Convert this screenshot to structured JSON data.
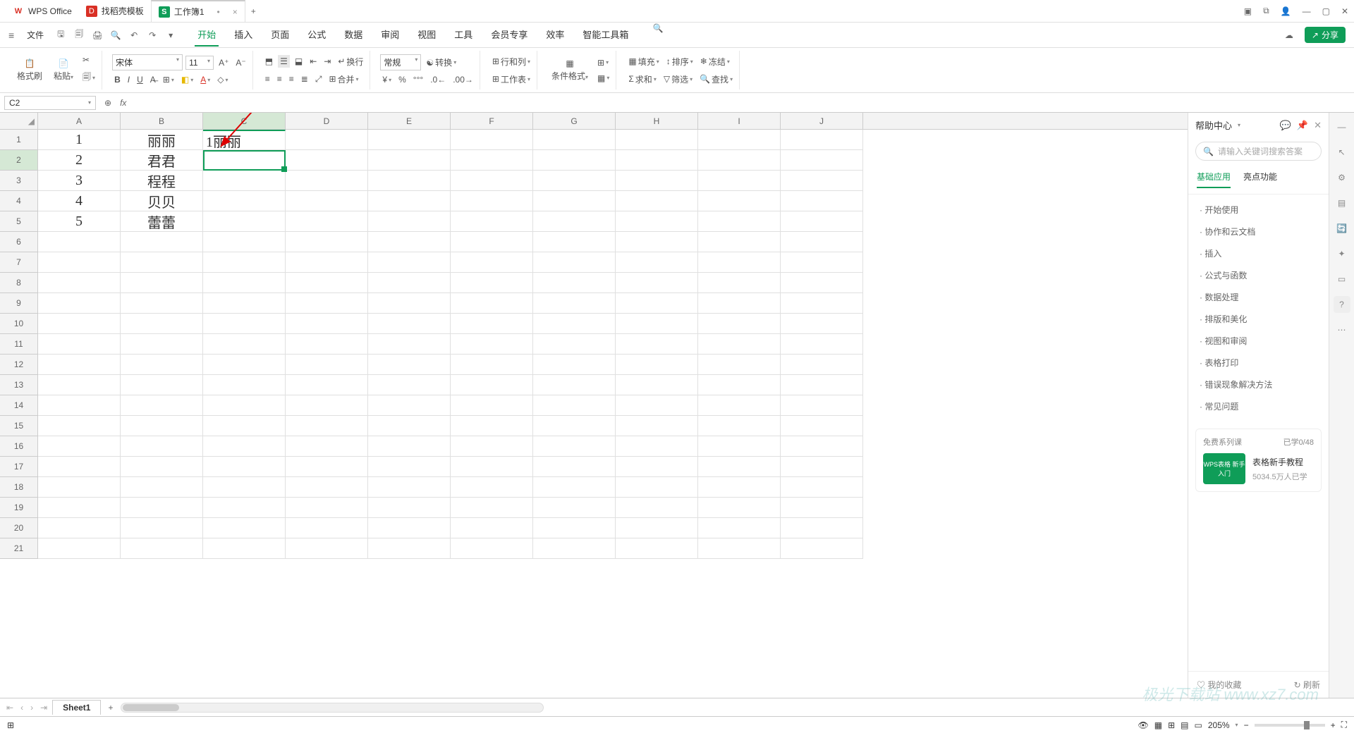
{
  "titlebar": {
    "tab1": "WPS Office",
    "tab2": "找稻壳模板",
    "tab3": "工作簿1",
    "tab3_icon": "S",
    "close": "×",
    "dot": "•",
    "add": "+"
  },
  "menubar": {
    "file": "文件",
    "tabs": [
      "开始",
      "插入",
      "页面",
      "公式",
      "数据",
      "审阅",
      "视图",
      "工具",
      "会员专享",
      "效率",
      "智能工具箱"
    ],
    "share": "分享"
  },
  "ribbon": {
    "format_painter": "格式刷",
    "paste": "粘贴",
    "font": "宋体",
    "size": "11",
    "wrap": "换行",
    "merge": "合并",
    "number_format": "常规",
    "convert": "转换",
    "rowcol": "行和列",
    "worksheet": "工作表",
    "cond_fmt": "条件格式",
    "fill": "填充",
    "sort": "排序",
    "freeze": "冻结",
    "sum": "求和",
    "filter": "筛选",
    "find": "查找"
  },
  "formula": {
    "namebox": "C2",
    "fx": "fx"
  },
  "columns": [
    "A",
    "B",
    "C",
    "D",
    "E",
    "F",
    "G",
    "H",
    "I",
    "J"
  ],
  "rows": [
    1,
    2,
    3,
    4,
    5,
    6,
    7,
    8,
    9,
    10,
    11,
    12,
    13,
    14,
    15,
    16,
    17,
    18,
    19,
    20,
    21
  ],
  "cells": {
    "A1": "1",
    "A2": "2",
    "A3": "3",
    "A4": "4",
    "A5": "5",
    "B1": "丽丽",
    "B2": "君君",
    "B3": "程程",
    "B4": "贝贝",
    "B5": "蕾蕾",
    "C1": "1丽丽"
  },
  "help": {
    "title": "帮助中心",
    "search_ph": "请输入关键词搜索答案",
    "tab_basic": "基础应用",
    "tab_highlight": "亮点功能",
    "items": [
      "开始使用",
      "协作和云文档",
      "插入",
      "公式与函数",
      "数据处理",
      "排版和美化",
      "视图和审阅",
      "表格打印",
      "错误现象解决方法",
      "常见问题"
    ],
    "course_label": "免费系列课",
    "course_count": "已学0/48",
    "course_thumb": "WPS表格\n新手入门",
    "course_title": "表格新手教程",
    "course_sub": "5034.5万人已学",
    "fav": "我的收藏",
    "refresh": "刷新"
  },
  "sheet": {
    "name": "Sheet1"
  },
  "status": {
    "zoom": "205%"
  },
  "watermark": "极光下载站\nwww.xz7.com"
}
